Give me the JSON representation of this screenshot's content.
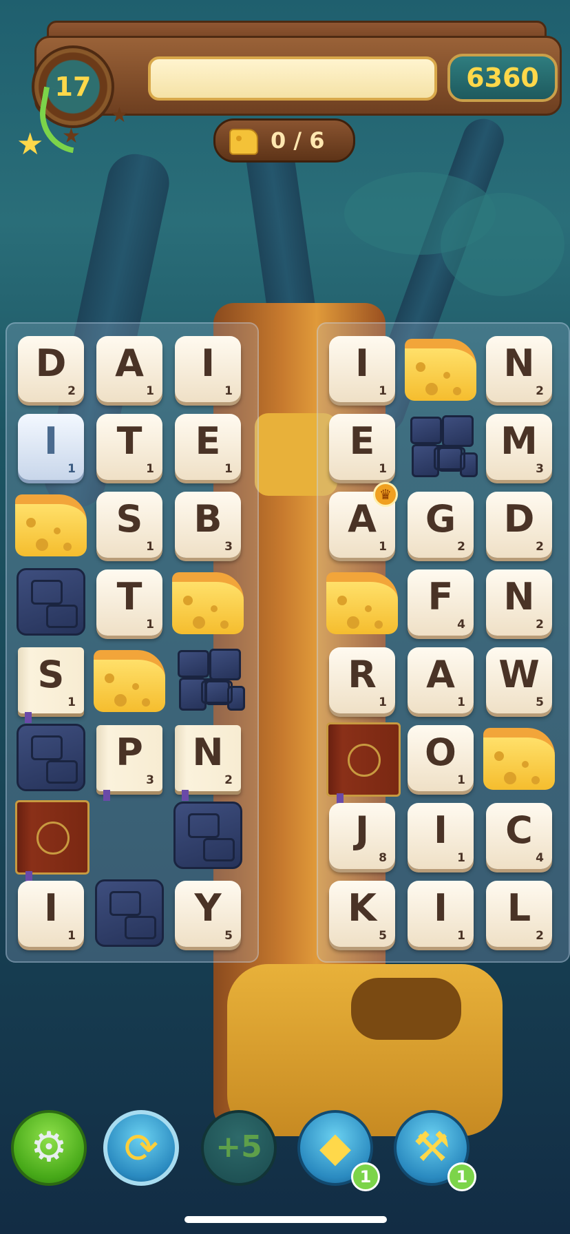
{
  "level": "17",
  "score": "6360",
  "goal": {
    "icon": "cheese-icon",
    "progress": "0 / 6",
    "collected": 0,
    "target": 6
  },
  "progress_fraction": 0.0,
  "left_board": {
    "tiles": [
      {
        "type": "letter",
        "letter": "D",
        "score": "2"
      },
      {
        "type": "letter",
        "letter": "A",
        "score": "1"
      },
      {
        "type": "letter",
        "letter": "I",
        "score": "1"
      },
      {
        "type": "letter",
        "letter": "I",
        "score": "1",
        "variant": "glass"
      },
      {
        "type": "letter",
        "letter": "T",
        "score": "1"
      },
      {
        "type": "letter",
        "letter": "E",
        "score": "1"
      },
      {
        "type": "cheese"
      },
      {
        "type": "letter",
        "letter": "S",
        "score": "1"
      },
      {
        "type": "letter",
        "letter": "B",
        "score": "3"
      },
      {
        "type": "stone"
      },
      {
        "type": "letter",
        "letter": "T",
        "score": "1"
      },
      {
        "type": "cheese"
      },
      {
        "type": "letter",
        "letter": "S",
        "score": "1",
        "variant": "paper"
      },
      {
        "type": "cheese"
      },
      {
        "type": "stone-broken"
      },
      {
        "type": "stone"
      },
      {
        "type": "letter",
        "letter": "P",
        "score": "3",
        "variant": "paper"
      },
      {
        "type": "letter",
        "letter": "N",
        "score": "2",
        "variant": "paper"
      },
      {
        "type": "book"
      },
      {
        "type": "empty"
      },
      {
        "type": "stone"
      },
      {
        "type": "letter",
        "letter": "I",
        "score": "1"
      },
      {
        "type": "stone"
      },
      {
        "type": "letter",
        "letter": "Y",
        "score": "5"
      }
    ]
  },
  "right_board": {
    "tiles": [
      {
        "type": "letter",
        "letter": "I",
        "score": "1"
      },
      {
        "type": "cheese"
      },
      {
        "type": "letter",
        "letter": "N",
        "score": "2"
      },
      {
        "type": "letter",
        "letter": "E",
        "score": "1"
      },
      {
        "type": "stone-broken"
      },
      {
        "type": "letter",
        "letter": "M",
        "score": "3"
      },
      {
        "type": "letter",
        "letter": "A",
        "score": "1",
        "crown": true
      },
      {
        "type": "letter",
        "letter": "G",
        "score": "2"
      },
      {
        "type": "letter",
        "letter": "D",
        "score": "2"
      },
      {
        "type": "cheese"
      },
      {
        "type": "letter",
        "letter": "F",
        "score": "4"
      },
      {
        "type": "letter",
        "letter": "N",
        "score": "2"
      },
      {
        "type": "letter",
        "letter": "R",
        "score": "1"
      },
      {
        "type": "letter",
        "letter": "A",
        "score": "1"
      },
      {
        "type": "letter",
        "letter": "W",
        "score": "5"
      },
      {
        "type": "book"
      },
      {
        "type": "letter",
        "letter": "O",
        "score": "1"
      },
      {
        "type": "cheese"
      },
      {
        "type": "letter",
        "letter": "J",
        "score": "8"
      },
      {
        "type": "letter",
        "letter": "I",
        "score": "1"
      },
      {
        "type": "letter",
        "letter": "C",
        "score": "4"
      },
      {
        "type": "letter",
        "letter": "K",
        "score": "5"
      },
      {
        "type": "letter",
        "letter": "I",
        "score": "1"
      },
      {
        "type": "letter",
        "letter": "L",
        "score": "2"
      }
    ]
  },
  "toolbar": {
    "settings_icon": "gear-icon",
    "shuffle_icon": "shuffle-arrows-icon",
    "plus5_icon": "plus-five-icon",
    "dice_icon": "dice-icon",
    "dice_count": "1",
    "hammer_icon": "hammer-icon",
    "hammer_count": "1"
  },
  "colors": {
    "accent": "#ffd84a",
    "tile": "#f5ead6",
    "letter": "#4a3326",
    "badge": "#7cd44a"
  }
}
